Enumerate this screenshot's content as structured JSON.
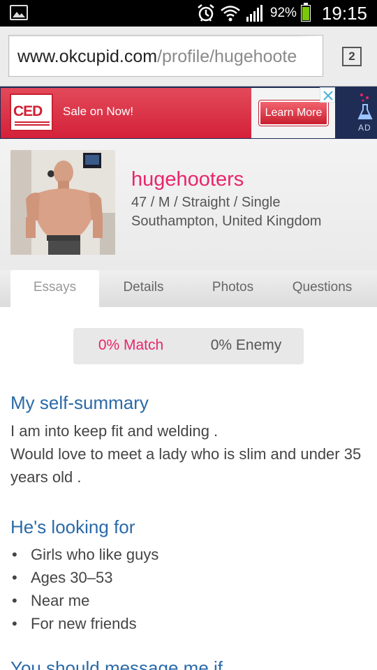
{
  "status_bar": {
    "battery": "92%",
    "time": "19:15",
    "battery_level_percent": 92,
    "icons": [
      "gallery-icon",
      "alarm-icon",
      "wifi-icon",
      "signal-icon",
      "battery-icon"
    ]
  },
  "browser": {
    "url_domain": "www.okcupid.com",
    "url_path": "/profile/hugehoote",
    "tab_count": "2"
  },
  "ad": {
    "logo_text": "CED",
    "headline": "Sale on Now!",
    "cta": "Learn More",
    "label": "AD",
    "brand_color": "#d4213a"
  },
  "profile": {
    "username": "hugehooters",
    "details": "47 / M / Straight / Single",
    "location": "Southampton, United Kingdom",
    "accent_color": "#e8256b"
  },
  "tabs": [
    {
      "label": "Essays",
      "active": true
    },
    {
      "label": "Details",
      "active": false
    },
    {
      "label": "Photos",
      "active": false
    },
    {
      "label": "Questions",
      "active": false
    }
  ],
  "match": {
    "match_label": "0% Match",
    "enemy_label": "0% Enemy"
  },
  "essays": {
    "self_summary": {
      "heading": "My self-summary",
      "lines": [
        "I am into keep fit and welding .",
        "Would love to meet a lady who is slim and under 35 years old ."
      ]
    },
    "looking_for": {
      "heading": "He's looking for",
      "items": [
        "Girls who like guys",
        "Ages 30–53",
        "Near me",
        "For new friends"
      ]
    },
    "next_heading_partial": "You should message me if..."
  }
}
